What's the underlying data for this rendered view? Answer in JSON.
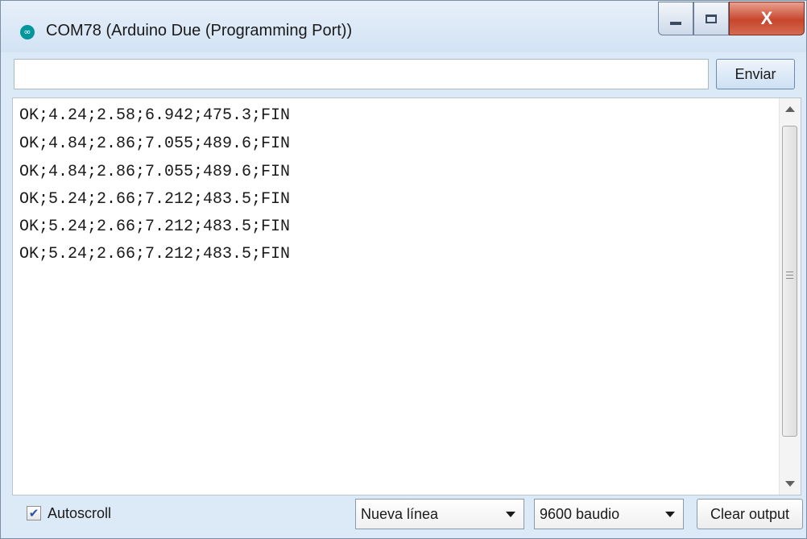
{
  "window": {
    "title": "COM78 (Arduino Due (Programming Port))",
    "close_glyph": "X",
    "app_icon": "arduino-logo-icon"
  },
  "input": {
    "value": "",
    "placeholder": ""
  },
  "send_button": {
    "label": "Enviar"
  },
  "output": {
    "lines": [
      "OK;4.24;2.58;6.942;475.3;FIN",
      "OK;4.84;2.86;7.055;489.6;FIN",
      "OK;4.84;2.86;7.055;489.6;FIN",
      "OK;5.24;2.66;7.212;483.5;FIN",
      "OK;5.24;2.66;7.212;483.5;FIN",
      "OK;5.24;2.66;7.212;483.5;FIN"
    ]
  },
  "footer": {
    "autoscroll_label": "Autoscroll",
    "autoscroll_checked": true,
    "line_ending": "Nueva línea",
    "baud_rate": "9600 baudio",
    "clear_label": "Clear output"
  },
  "colors": {
    "accent": "#00979c",
    "close_red": "#c7462c",
    "frame": "#dce9f6"
  }
}
